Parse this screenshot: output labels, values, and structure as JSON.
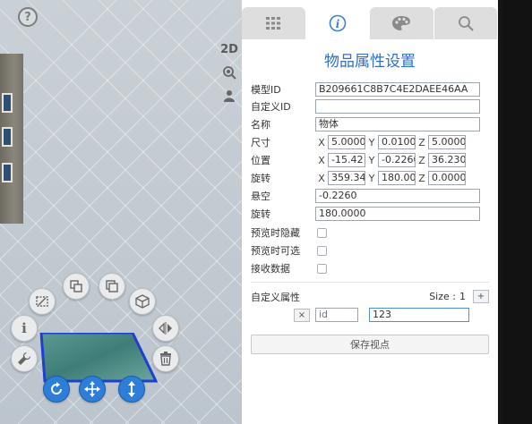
{
  "viewport": {
    "help_icon": "question-circle-icon",
    "side_strip": {
      "view_2d_label": "2D",
      "icons": [
        "zoom-globe-icon",
        "person-icon"
      ]
    },
    "tools": [
      "edit-area-icon",
      "copy-icon",
      "copy-icon",
      "cube-icon",
      "info-icon",
      "mirror-icon",
      "wrench-icon",
      "trash-icon",
      "rotate-icon",
      "move-icon",
      "vertical-move-icon"
    ],
    "tool_colors": {
      "accent": "#2d7ed8",
      "plate": "#4a8f8a",
      "plate_border": "#1f3fd1"
    }
  },
  "panel": {
    "tabs": [
      {
        "icon": "grid-icon",
        "active": false
      },
      {
        "icon": "info-icon",
        "active": true
      },
      {
        "icon": "palette-icon",
        "active": false
      },
      {
        "icon": "search-icon",
        "active": false
      }
    ],
    "title": "物品属性设置",
    "fields": {
      "model_id": {
        "label": "模型ID",
        "value": "B209661C8B7C4E2DAEE46AA"
      },
      "custom_id": {
        "label": "自定义ID",
        "value": ""
      },
      "name": {
        "label": "名称",
        "value": "物体"
      },
      "size": {
        "label": "尺寸",
        "x": "5.0000",
        "y": "0.0100",
        "z": "5.0000"
      },
      "position": {
        "label": "位置",
        "x": "-15.42",
        "y": "-0.2260",
        "z": "36.230"
      },
      "rotation": {
        "label": "旋转",
        "x": "359.34",
        "y": "180.00",
        "z": "0.0000"
      },
      "hover": {
        "label": "悬空",
        "value": "-0.2260"
      },
      "rotate2": {
        "label": "旋转",
        "value": "180.0000"
      }
    },
    "axes": {
      "x": "X",
      "y": "Y",
      "z": "Z"
    },
    "checks": [
      {
        "label": "预览时隐藏",
        "checked": false
      },
      {
        "label": "预览时可选",
        "checked": false
      },
      {
        "label": "接收数据",
        "checked": false
      }
    ],
    "custom": {
      "label": "自定义属性",
      "size_label": "Size :",
      "size_value": "1",
      "add_label": "+",
      "remove_label": "×",
      "key_placeholder": "id",
      "value": "123"
    },
    "save_label": "保存视点"
  }
}
